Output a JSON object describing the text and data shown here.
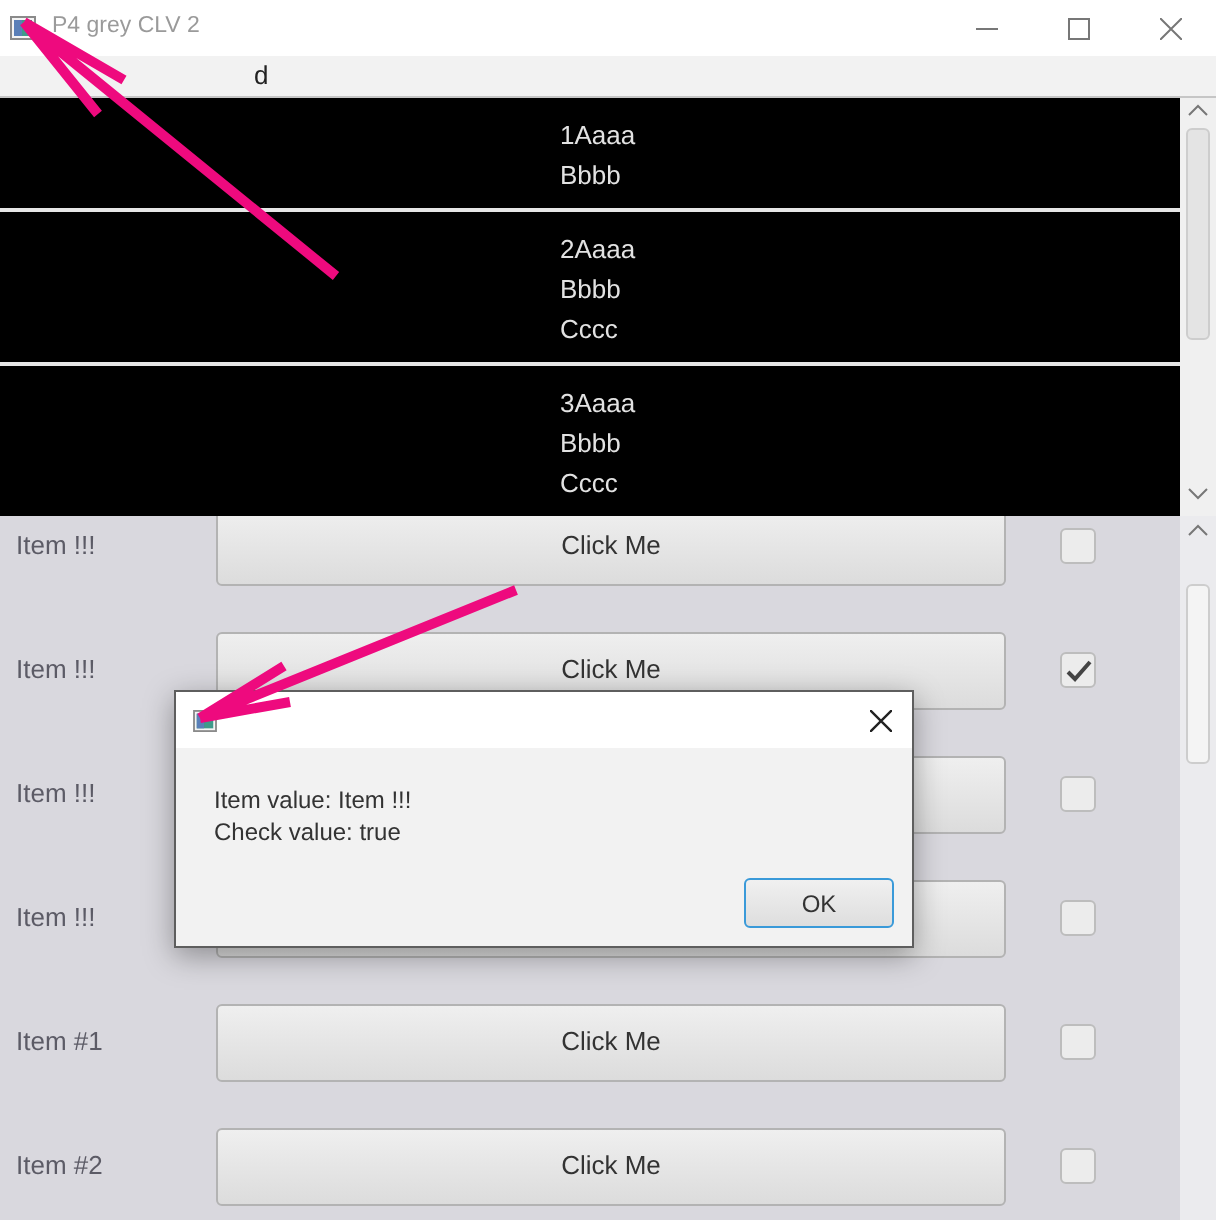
{
  "window": {
    "title": "P4 grey CLV 2"
  },
  "header": {
    "label": "d"
  },
  "cell_list": {
    "cells": [
      {
        "lines": [
          "1Aaaa",
          "Bbbb"
        ]
      },
      {
        "lines": [
          "2Aaaa",
          "Bbbb",
          "Cccc"
        ]
      },
      {
        "lines": [
          "3Aaaa",
          "Bbbb",
          "Cccc"
        ]
      }
    ]
  },
  "item_list": {
    "rows": [
      {
        "label": "Item !!!",
        "button": "Click Me",
        "checked": false
      },
      {
        "label": "Item !!!",
        "button": "Click Me",
        "checked": true
      },
      {
        "label": "Item !!!",
        "checked": false
      },
      {
        "label": "Item !!!",
        "checked": false
      },
      {
        "label": "Item #1",
        "button": "Click Me",
        "checked": false
      },
      {
        "label": "Item #2",
        "button": "Click Me",
        "checked": false
      }
    ]
  },
  "dialog": {
    "message": [
      "Item value: Item !!!",
      "Check value: true"
    ],
    "button": "OK"
  }
}
